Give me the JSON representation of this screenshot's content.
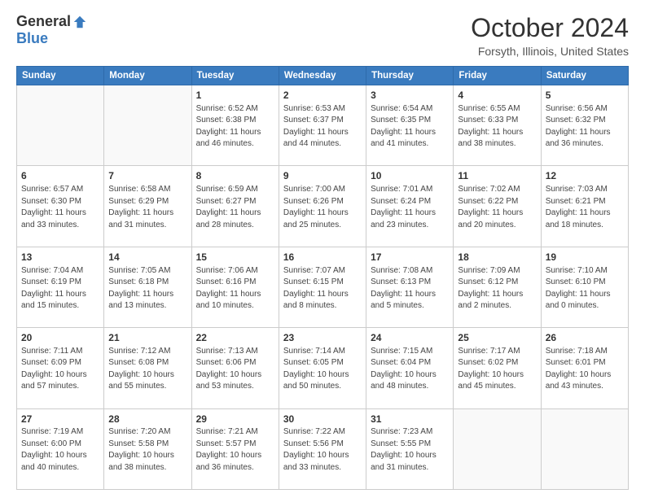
{
  "logo": {
    "general": "General",
    "blue": "Blue"
  },
  "title": "October 2024",
  "location": "Forsyth, Illinois, United States",
  "days_of_week": [
    "Sunday",
    "Monday",
    "Tuesday",
    "Wednesday",
    "Thursday",
    "Friday",
    "Saturday"
  ],
  "weeks": [
    [
      {
        "day": "",
        "info": ""
      },
      {
        "day": "",
        "info": ""
      },
      {
        "day": "1",
        "info": "Sunrise: 6:52 AM\nSunset: 6:38 PM\nDaylight: 11 hours and 46 minutes."
      },
      {
        "day": "2",
        "info": "Sunrise: 6:53 AM\nSunset: 6:37 PM\nDaylight: 11 hours and 44 minutes."
      },
      {
        "day": "3",
        "info": "Sunrise: 6:54 AM\nSunset: 6:35 PM\nDaylight: 11 hours and 41 minutes."
      },
      {
        "day": "4",
        "info": "Sunrise: 6:55 AM\nSunset: 6:33 PM\nDaylight: 11 hours and 38 minutes."
      },
      {
        "day": "5",
        "info": "Sunrise: 6:56 AM\nSunset: 6:32 PM\nDaylight: 11 hours and 36 minutes."
      }
    ],
    [
      {
        "day": "6",
        "info": "Sunrise: 6:57 AM\nSunset: 6:30 PM\nDaylight: 11 hours and 33 minutes."
      },
      {
        "day": "7",
        "info": "Sunrise: 6:58 AM\nSunset: 6:29 PM\nDaylight: 11 hours and 31 minutes."
      },
      {
        "day": "8",
        "info": "Sunrise: 6:59 AM\nSunset: 6:27 PM\nDaylight: 11 hours and 28 minutes."
      },
      {
        "day": "9",
        "info": "Sunrise: 7:00 AM\nSunset: 6:26 PM\nDaylight: 11 hours and 25 minutes."
      },
      {
        "day": "10",
        "info": "Sunrise: 7:01 AM\nSunset: 6:24 PM\nDaylight: 11 hours and 23 minutes."
      },
      {
        "day": "11",
        "info": "Sunrise: 7:02 AM\nSunset: 6:22 PM\nDaylight: 11 hours and 20 minutes."
      },
      {
        "day": "12",
        "info": "Sunrise: 7:03 AM\nSunset: 6:21 PM\nDaylight: 11 hours and 18 minutes."
      }
    ],
    [
      {
        "day": "13",
        "info": "Sunrise: 7:04 AM\nSunset: 6:19 PM\nDaylight: 11 hours and 15 minutes."
      },
      {
        "day": "14",
        "info": "Sunrise: 7:05 AM\nSunset: 6:18 PM\nDaylight: 11 hours and 13 minutes."
      },
      {
        "day": "15",
        "info": "Sunrise: 7:06 AM\nSunset: 6:16 PM\nDaylight: 11 hours and 10 minutes."
      },
      {
        "day": "16",
        "info": "Sunrise: 7:07 AM\nSunset: 6:15 PM\nDaylight: 11 hours and 8 minutes."
      },
      {
        "day": "17",
        "info": "Sunrise: 7:08 AM\nSunset: 6:13 PM\nDaylight: 11 hours and 5 minutes."
      },
      {
        "day": "18",
        "info": "Sunrise: 7:09 AM\nSunset: 6:12 PM\nDaylight: 11 hours and 2 minutes."
      },
      {
        "day": "19",
        "info": "Sunrise: 7:10 AM\nSunset: 6:10 PM\nDaylight: 11 hours and 0 minutes."
      }
    ],
    [
      {
        "day": "20",
        "info": "Sunrise: 7:11 AM\nSunset: 6:09 PM\nDaylight: 10 hours and 57 minutes."
      },
      {
        "day": "21",
        "info": "Sunrise: 7:12 AM\nSunset: 6:08 PM\nDaylight: 10 hours and 55 minutes."
      },
      {
        "day": "22",
        "info": "Sunrise: 7:13 AM\nSunset: 6:06 PM\nDaylight: 10 hours and 53 minutes."
      },
      {
        "day": "23",
        "info": "Sunrise: 7:14 AM\nSunset: 6:05 PM\nDaylight: 10 hours and 50 minutes."
      },
      {
        "day": "24",
        "info": "Sunrise: 7:15 AM\nSunset: 6:04 PM\nDaylight: 10 hours and 48 minutes."
      },
      {
        "day": "25",
        "info": "Sunrise: 7:17 AM\nSunset: 6:02 PM\nDaylight: 10 hours and 45 minutes."
      },
      {
        "day": "26",
        "info": "Sunrise: 7:18 AM\nSunset: 6:01 PM\nDaylight: 10 hours and 43 minutes."
      }
    ],
    [
      {
        "day": "27",
        "info": "Sunrise: 7:19 AM\nSunset: 6:00 PM\nDaylight: 10 hours and 40 minutes."
      },
      {
        "day": "28",
        "info": "Sunrise: 7:20 AM\nSunset: 5:58 PM\nDaylight: 10 hours and 38 minutes."
      },
      {
        "day": "29",
        "info": "Sunrise: 7:21 AM\nSunset: 5:57 PM\nDaylight: 10 hours and 36 minutes."
      },
      {
        "day": "30",
        "info": "Sunrise: 7:22 AM\nSunset: 5:56 PM\nDaylight: 10 hours and 33 minutes."
      },
      {
        "day": "31",
        "info": "Sunrise: 7:23 AM\nSunset: 5:55 PM\nDaylight: 10 hours and 31 minutes."
      },
      {
        "day": "",
        "info": ""
      },
      {
        "day": "",
        "info": ""
      }
    ]
  ]
}
